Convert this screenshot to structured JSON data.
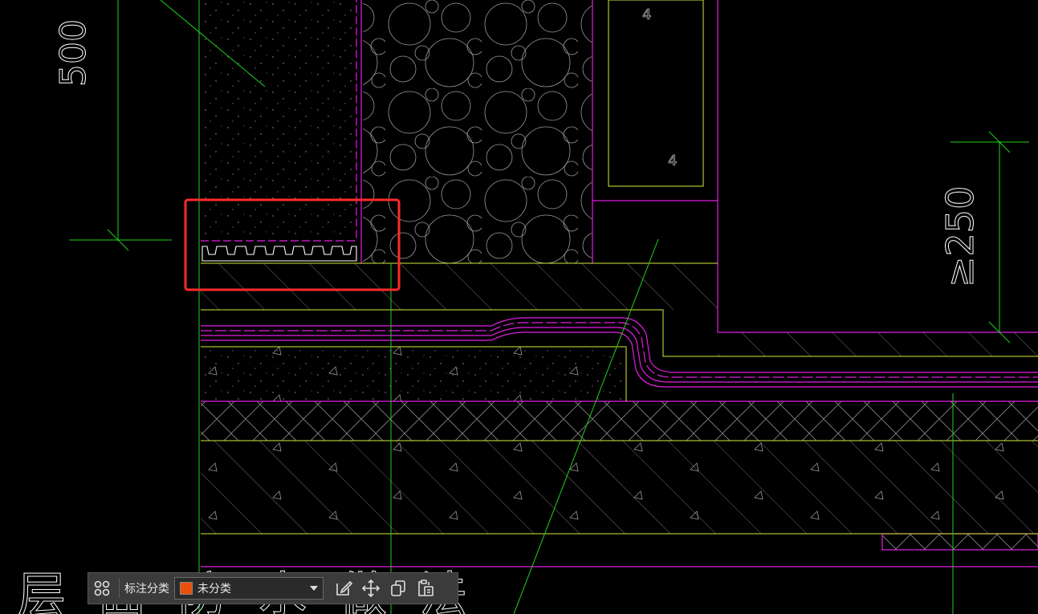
{
  "drawing": {
    "dimensions": {
      "dim_500": "500",
      "dim_250": "≥250"
    },
    "hatch_marks": {
      "mark_a": "4",
      "mark_b": "4"
    },
    "bottom_text": "层面防水做法"
  },
  "toolbar": {
    "label": "标注分类",
    "category_value": "未分类",
    "category_color": "#e8500e",
    "icons": [
      "grid-icon",
      "edit-note-icon",
      "move-icon",
      "copy-icon",
      "paste-icon"
    ]
  },
  "colors": {
    "highlight": "#ff2a2a",
    "green": "#1ed21e",
    "magenta": "#e21ee2",
    "yellow": "#d8e83c",
    "white": "#ffffff"
  }
}
